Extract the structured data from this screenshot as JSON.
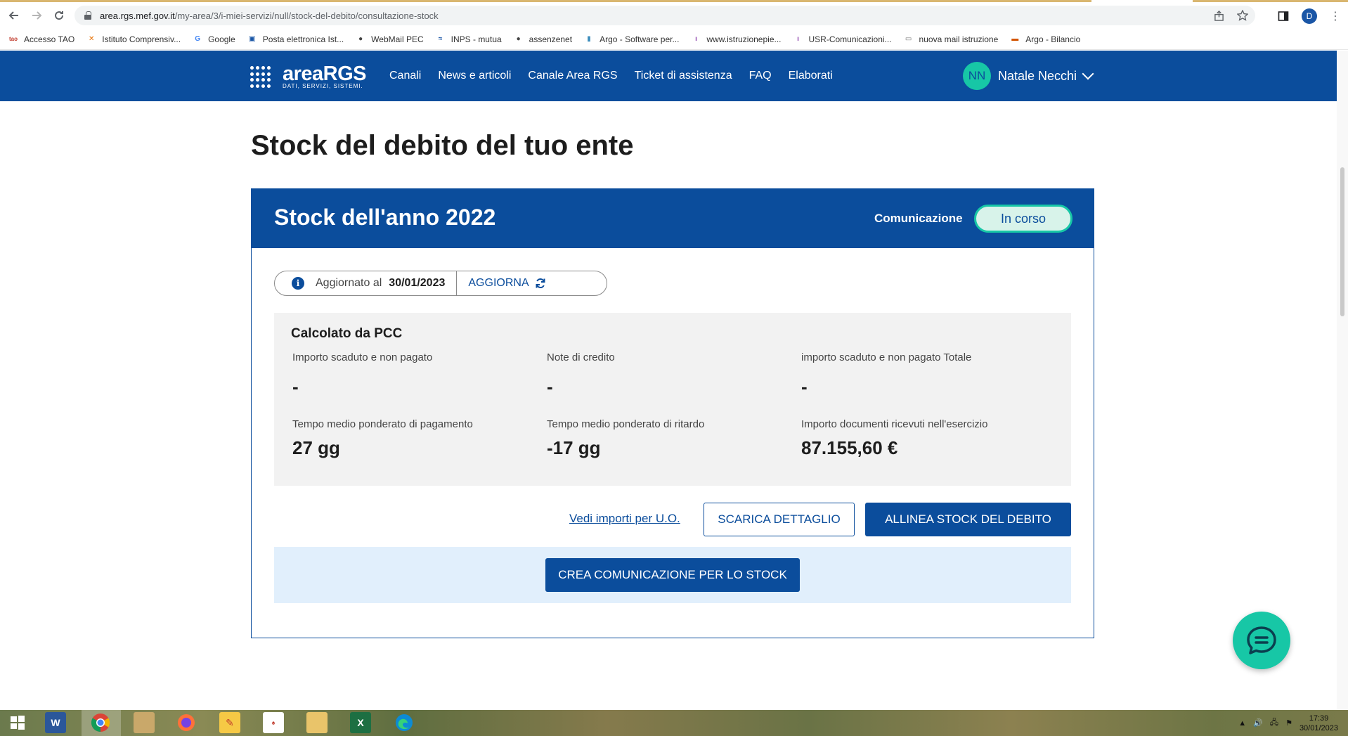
{
  "browser": {
    "url_host": "area.rgs.mef.gov.it",
    "url_path": "/my-area/3/i-miei-servizi/null/stock-del-debito/consultazione-stock",
    "profile_initial": "D"
  },
  "bookmarks": [
    {
      "label": "Accesso TAO",
      "icon": "tao",
      "color": "#c0392b"
    },
    {
      "label": "Istituto Comprensiv...",
      "icon": "joomla",
      "color": "#e76f00"
    },
    {
      "label": "Google",
      "icon": "G",
      "color": "#4285f4"
    },
    {
      "label": "Posta elettronica Ist...",
      "icon": "mail",
      "color": "#1a56a6"
    },
    {
      "label": "WebMail PEC",
      "icon": "globe",
      "color": "#444444"
    },
    {
      "label": "INPS - mutua",
      "icon": "inps",
      "color": "#1a56a6"
    },
    {
      "label": "assenzenet",
      "icon": "globe",
      "color": "#444444"
    },
    {
      "label": "Argo - Software per...",
      "icon": "argo",
      "color": "#3c8dbc"
    },
    {
      "label": "www.istruzionepie...",
      "icon": "bars",
      "color": "#8e44ad"
    },
    {
      "label": "USR-Comunicazioni...",
      "icon": "bars",
      "color": "#8e44ad"
    },
    {
      "label": "nuova mail istruzione",
      "icon": "doc",
      "color": "#777777"
    },
    {
      "label": "Argo - Bilancio",
      "icon": "argo2",
      "color": "#d35400"
    }
  ],
  "header": {
    "logo_main": "areaRGS",
    "logo_sub": "DATI, SERVIZI, SISTEMI.",
    "nav": [
      "Canali",
      "News e articoli",
      "Canale Area RGS",
      "Ticket di assistenza",
      "FAQ",
      "Elaborati"
    ],
    "user_initials": "NN",
    "user_name": "Natale Necchi"
  },
  "page": {
    "title": "Stock del debito del tuo ente",
    "card_title": "Stock dell'anno 2022",
    "communication_label": "Comunicazione",
    "status": "In corso",
    "updated_label": "Aggiornato al",
    "updated_date": "30/01/2023",
    "refresh_label": "AGGIORNA",
    "pcc_title": "Calcolato da PCC",
    "metrics": [
      {
        "label": "Importo scaduto e non pagato",
        "value": "-"
      },
      {
        "label": "Note di credito",
        "value": "-"
      },
      {
        "label": "importo scaduto e non pagato Totale",
        "value": "-"
      },
      {
        "label": "Tempo medio ponderato di pagamento",
        "value": "27 gg"
      },
      {
        "label": "Tempo medio ponderato di ritardo",
        "value": "-17 gg"
      },
      {
        "label": "Importo documenti ricevuti nell'esercizio",
        "value": "87.155,60 €"
      }
    ],
    "link_uo": "Vedi importi per U.O.",
    "download_label": "SCARICA DETTAGLIO",
    "align_label": "ALLINEA STOCK DEL DEBITO",
    "create_label": "CREA COMUNICAZIONE PER LO STOCK"
  },
  "taskbar": {
    "time": "17:39",
    "date": "30/01/2023"
  }
}
